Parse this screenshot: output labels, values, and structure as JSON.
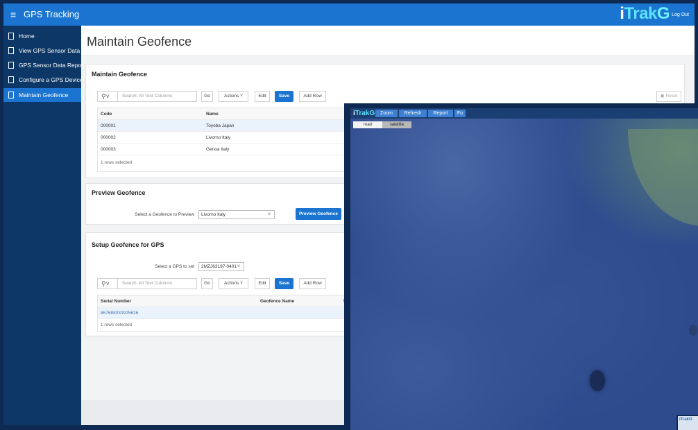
{
  "app": {
    "title": "GPS Tracking",
    "menu_icon": "hamburger-icon",
    "logo": {
      "i": "i",
      "trak": "Trak",
      "g": "G"
    },
    "logout_label": "Log Out"
  },
  "sidebar": {
    "items": [
      {
        "label": "Home",
        "icon": "document-icon",
        "active": false
      },
      {
        "label": "View GPS Sensor Data a...",
        "icon": "document-icon",
        "active": false
      },
      {
        "label": "GPS Sensor Data Report",
        "icon": "document-icon",
        "active": false
      },
      {
        "label": "Configure a GPS Device",
        "icon": "document-icon",
        "active": false
      },
      {
        "label": "Maintain Geofence",
        "icon": "document-icon",
        "active": true
      }
    ]
  },
  "page": {
    "title": "Maintain Geofence"
  },
  "maintain": {
    "title": "Maintain Geofence",
    "search_placeholder": "Search: All Text Columns",
    "go_label": "Go",
    "actions_label": "Actions",
    "edit_label": "Edit",
    "save_label": "Save",
    "add_row_label": "Add Row",
    "reset_label": "Reset",
    "columns": [
      "Code",
      "Name"
    ],
    "rows": [
      {
        "code": "000001",
        "name": "Toyoba Japan"
      },
      {
        "code": "000002",
        "name": "Livorno Italy"
      },
      {
        "code": "000003",
        "name": "Genoa Italy"
      }
    ],
    "footer": "1 rows selected"
  },
  "preview": {
    "title": "Preview Geofence",
    "select_label": "Select a Geofence to Preview",
    "selected": "Livorno Italy",
    "button_label": "Preview Geofence"
  },
  "setup": {
    "title": "Setup Geofence for GPS",
    "select_label": "Select a GPS to set",
    "selected": "2MZJ63197-0401",
    "search_placeholder": "Search: All Text Columns",
    "go_label": "Go",
    "actions_label": "Actions",
    "edit_label": "Edit",
    "save_label": "Save",
    "add_row_label": "Add Row",
    "columns": [
      "Serial Number",
      "Geofence Name",
      "Un"
    ],
    "rows": [
      {
        "serial": "867688030925626"
      }
    ],
    "footer": "1 rows selected"
  },
  "map": {
    "logo": {
      "i": "i",
      "trak": "Trak",
      "g": "G"
    },
    "tabs": [
      "Zoom",
      "Refresh",
      "Report",
      "Fu"
    ],
    "types": [
      "road",
      "satellite"
    ],
    "mini_logo": "iTrakG"
  }
}
